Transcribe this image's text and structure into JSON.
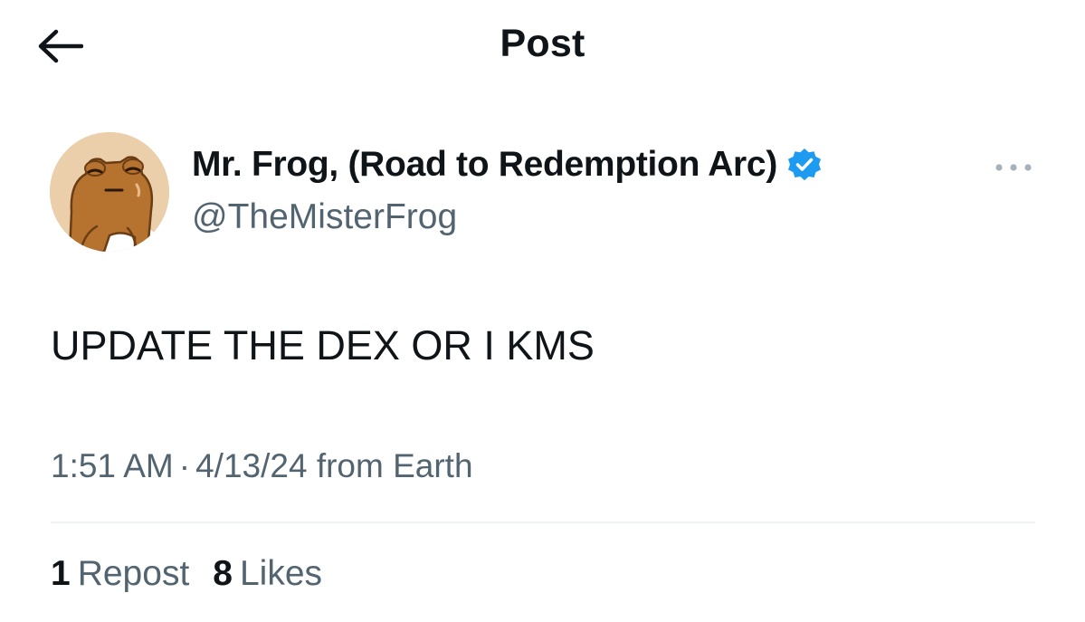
{
  "header": {
    "title": "Post",
    "back_icon": "arrow-left-icon"
  },
  "author": {
    "display_name": "Mr. Frog, (Road to Redemption Arc)",
    "handle": "@TheMisterFrog",
    "verified": true,
    "verified_badge_color": "#1d9bf0",
    "avatar_icon": "frog-avatar",
    "avatar_bg_color": "#ebcfaa"
  },
  "post": {
    "text": "UPDATE THE DEX OR I KMS",
    "time": "1:51 AM",
    "separator": "·",
    "date": "4/13/24",
    "location": "from Earth"
  },
  "stats": {
    "reposts_count": "1",
    "reposts_label": "Repost",
    "likes_count": "8",
    "likes_label": "Likes"
  },
  "more_icon": "more-horizontal-icon",
  "colors": {
    "text_primary": "#0f1419",
    "text_secondary": "#536471",
    "divider": "#eff3f4"
  }
}
